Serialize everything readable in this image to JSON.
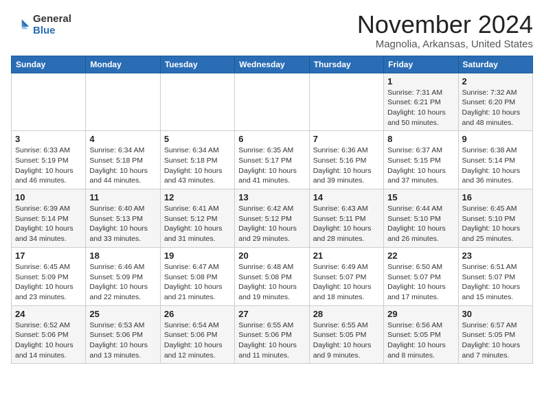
{
  "header": {
    "logo_general": "General",
    "logo_blue": "Blue",
    "title": "November 2024",
    "subtitle": "Magnolia, Arkansas, United States"
  },
  "days_of_week": [
    "Sunday",
    "Monday",
    "Tuesday",
    "Wednesday",
    "Thursday",
    "Friday",
    "Saturday"
  ],
  "weeks": [
    [
      {
        "day": "",
        "info": ""
      },
      {
        "day": "",
        "info": ""
      },
      {
        "day": "",
        "info": ""
      },
      {
        "day": "",
        "info": ""
      },
      {
        "day": "",
        "info": ""
      },
      {
        "day": "1",
        "info": "Sunrise: 7:31 AM\nSunset: 6:21 PM\nDaylight: 10 hours\nand 50 minutes."
      },
      {
        "day": "2",
        "info": "Sunrise: 7:32 AM\nSunset: 6:20 PM\nDaylight: 10 hours\nand 48 minutes."
      }
    ],
    [
      {
        "day": "3",
        "info": "Sunrise: 6:33 AM\nSunset: 5:19 PM\nDaylight: 10 hours\nand 46 minutes."
      },
      {
        "day": "4",
        "info": "Sunrise: 6:34 AM\nSunset: 5:18 PM\nDaylight: 10 hours\nand 44 minutes."
      },
      {
        "day": "5",
        "info": "Sunrise: 6:34 AM\nSunset: 5:18 PM\nDaylight: 10 hours\nand 43 minutes."
      },
      {
        "day": "6",
        "info": "Sunrise: 6:35 AM\nSunset: 5:17 PM\nDaylight: 10 hours\nand 41 minutes."
      },
      {
        "day": "7",
        "info": "Sunrise: 6:36 AM\nSunset: 5:16 PM\nDaylight: 10 hours\nand 39 minutes."
      },
      {
        "day": "8",
        "info": "Sunrise: 6:37 AM\nSunset: 5:15 PM\nDaylight: 10 hours\nand 37 minutes."
      },
      {
        "day": "9",
        "info": "Sunrise: 6:38 AM\nSunset: 5:14 PM\nDaylight: 10 hours\nand 36 minutes."
      }
    ],
    [
      {
        "day": "10",
        "info": "Sunrise: 6:39 AM\nSunset: 5:14 PM\nDaylight: 10 hours\nand 34 minutes."
      },
      {
        "day": "11",
        "info": "Sunrise: 6:40 AM\nSunset: 5:13 PM\nDaylight: 10 hours\nand 33 minutes."
      },
      {
        "day": "12",
        "info": "Sunrise: 6:41 AM\nSunset: 5:12 PM\nDaylight: 10 hours\nand 31 minutes."
      },
      {
        "day": "13",
        "info": "Sunrise: 6:42 AM\nSunset: 5:12 PM\nDaylight: 10 hours\nand 29 minutes."
      },
      {
        "day": "14",
        "info": "Sunrise: 6:43 AM\nSunset: 5:11 PM\nDaylight: 10 hours\nand 28 minutes."
      },
      {
        "day": "15",
        "info": "Sunrise: 6:44 AM\nSunset: 5:10 PM\nDaylight: 10 hours\nand 26 minutes."
      },
      {
        "day": "16",
        "info": "Sunrise: 6:45 AM\nSunset: 5:10 PM\nDaylight: 10 hours\nand 25 minutes."
      }
    ],
    [
      {
        "day": "17",
        "info": "Sunrise: 6:45 AM\nSunset: 5:09 PM\nDaylight: 10 hours\nand 23 minutes."
      },
      {
        "day": "18",
        "info": "Sunrise: 6:46 AM\nSunset: 5:09 PM\nDaylight: 10 hours\nand 22 minutes."
      },
      {
        "day": "19",
        "info": "Sunrise: 6:47 AM\nSunset: 5:08 PM\nDaylight: 10 hours\nand 21 minutes."
      },
      {
        "day": "20",
        "info": "Sunrise: 6:48 AM\nSunset: 5:08 PM\nDaylight: 10 hours\nand 19 minutes."
      },
      {
        "day": "21",
        "info": "Sunrise: 6:49 AM\nSunset: 5:07 PM\nDaylight: 10 hours\nand 18 minutes."
      },
      {
        "day": "22",
        "info": "Sunrise: 6:50 AM\nSunset: 5:07 PM\nDaylight: 10 hours\nand 17 minutes."
      },
      {
        "day": "23",
        "info": "Sunrise: 6:51 AM\nSunset: 5:07 PM\nDaylight: 10 hours\nand 15 minutes."
      }
    ],
    [
      {
        "day": "24",
        "info": "Sunrise: 6:52 AM\nSunset: 5:06 PM\nDaylight: 10 hours\nand 14 minutes."
      },
      {
        "day": "25",
        "info": "Sunrise: 6:53 AM\nSunset: 5:06 PM\nDaylight: 10 hours\nand 13 minutes."
      },
      {
        "day": "26",
        "info": "Sunrise: 6:54 AM\nSunset: 5:06 PM\nDaylight: 10 hours\nand 12 minutes."
      },
      {
        "day": "27",
        "info": "Sunrise: 6:55 AM\nSunset: 5:06 PM\nDaylight: 10 hours\nand 11 minutes."
      },
      {
        "day": "28",
        "info": "Sunrise: 6:55 AM\nSunset: 5:05 PM\nDaylight: 10 hours\nand 9 minutes."
      },
      {
        "day": "29",
        "info": "Sunrise: 6:56 AM\nSunset: 5:05 PM\nDaylight: 10 hours\nand 8 minutes."
      },
      {
        "day": "30",
        "info": "Sunrise: 6:57 AM\nSunset: 5:05 PM\nDaylight: 10 hours\nand 7 minutes."
      }
    ]
  ]
}
